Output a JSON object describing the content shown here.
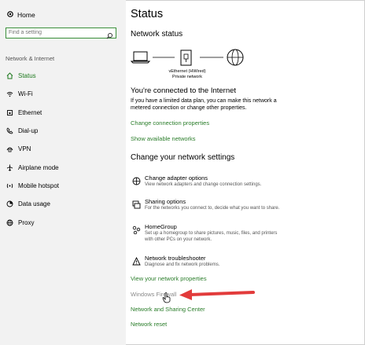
{
  "sidebar": {
    "home_label": "Home",
    "search_placeholder": "Find a setting",
    "section_label": "Network & Internet",
    "items": [
      {
        "label": "Status",
        "icon": "home-icon"
      },
      {
        "label": "Wi-Fi",
        "icon": "wifi-icon"
      },
      {
        "label": "Ethernet",
        "icon": "ethernet-icon"
      },
      {
        "label": "Dial-up",
        "icon": "phone-icon"
      },
      {
        "label": "VPN",
        "icon": "vpn-icon"
      },
      {
        "label": "Airplane mode",
        "icon": "airplane-icon"
      },
      {
        "label": "Mobile hotspot",
        "icon": "hotspot-icon"
      },
      {
        "label": "Data usage",
        "icon": "data-usage-icon"
      },
      {
        "label": "Proxy",
        "icon": "globe-icon"
      }
    ]
  },
  "main": {
    "title": "Status",
    "network_status_heading": "Network status",
    "adapter_name": "vEthernet (HWired)",
    "adapter_profile": "Private network",
    "connected_title": "You're connected to the Internet",
    "connected_desc": "If you have a limited data plan, you can make this network a metered connection or change other properties.",
    "links_top": [
      "Change connection properties",
      "Show available networks"
    ],
    "settings_heading": "Change your network settings",
    "options": [
      {
        "title": "Change adapter options",
        "desc": "View network adapters and change connection settings."
      },
      {
        "title": "Sharing options",
        "desc": "For the networks you connect to, decide what you want to share."
      },
      {
        "title": "HomeGroup",
        "desc": "Set up a homegroup to share pictures, music, files, and printers with other PCs on your network."
      },
      {
        "title": "Network troubleshooter",
        "desc": "Diagnose and fix network problems."
      }
    ],
    "links_bottom": [
      "View your network properties",
      "Windows Firewall",
      "Network and Sharing Center",
      "Network reset"
    ]
  },
  "colors": {
    "accent": "#2a7d2a",
    "sidebar_bg": "#f2f2f2",
    "arrow": "#e23b3b"
  }
}
